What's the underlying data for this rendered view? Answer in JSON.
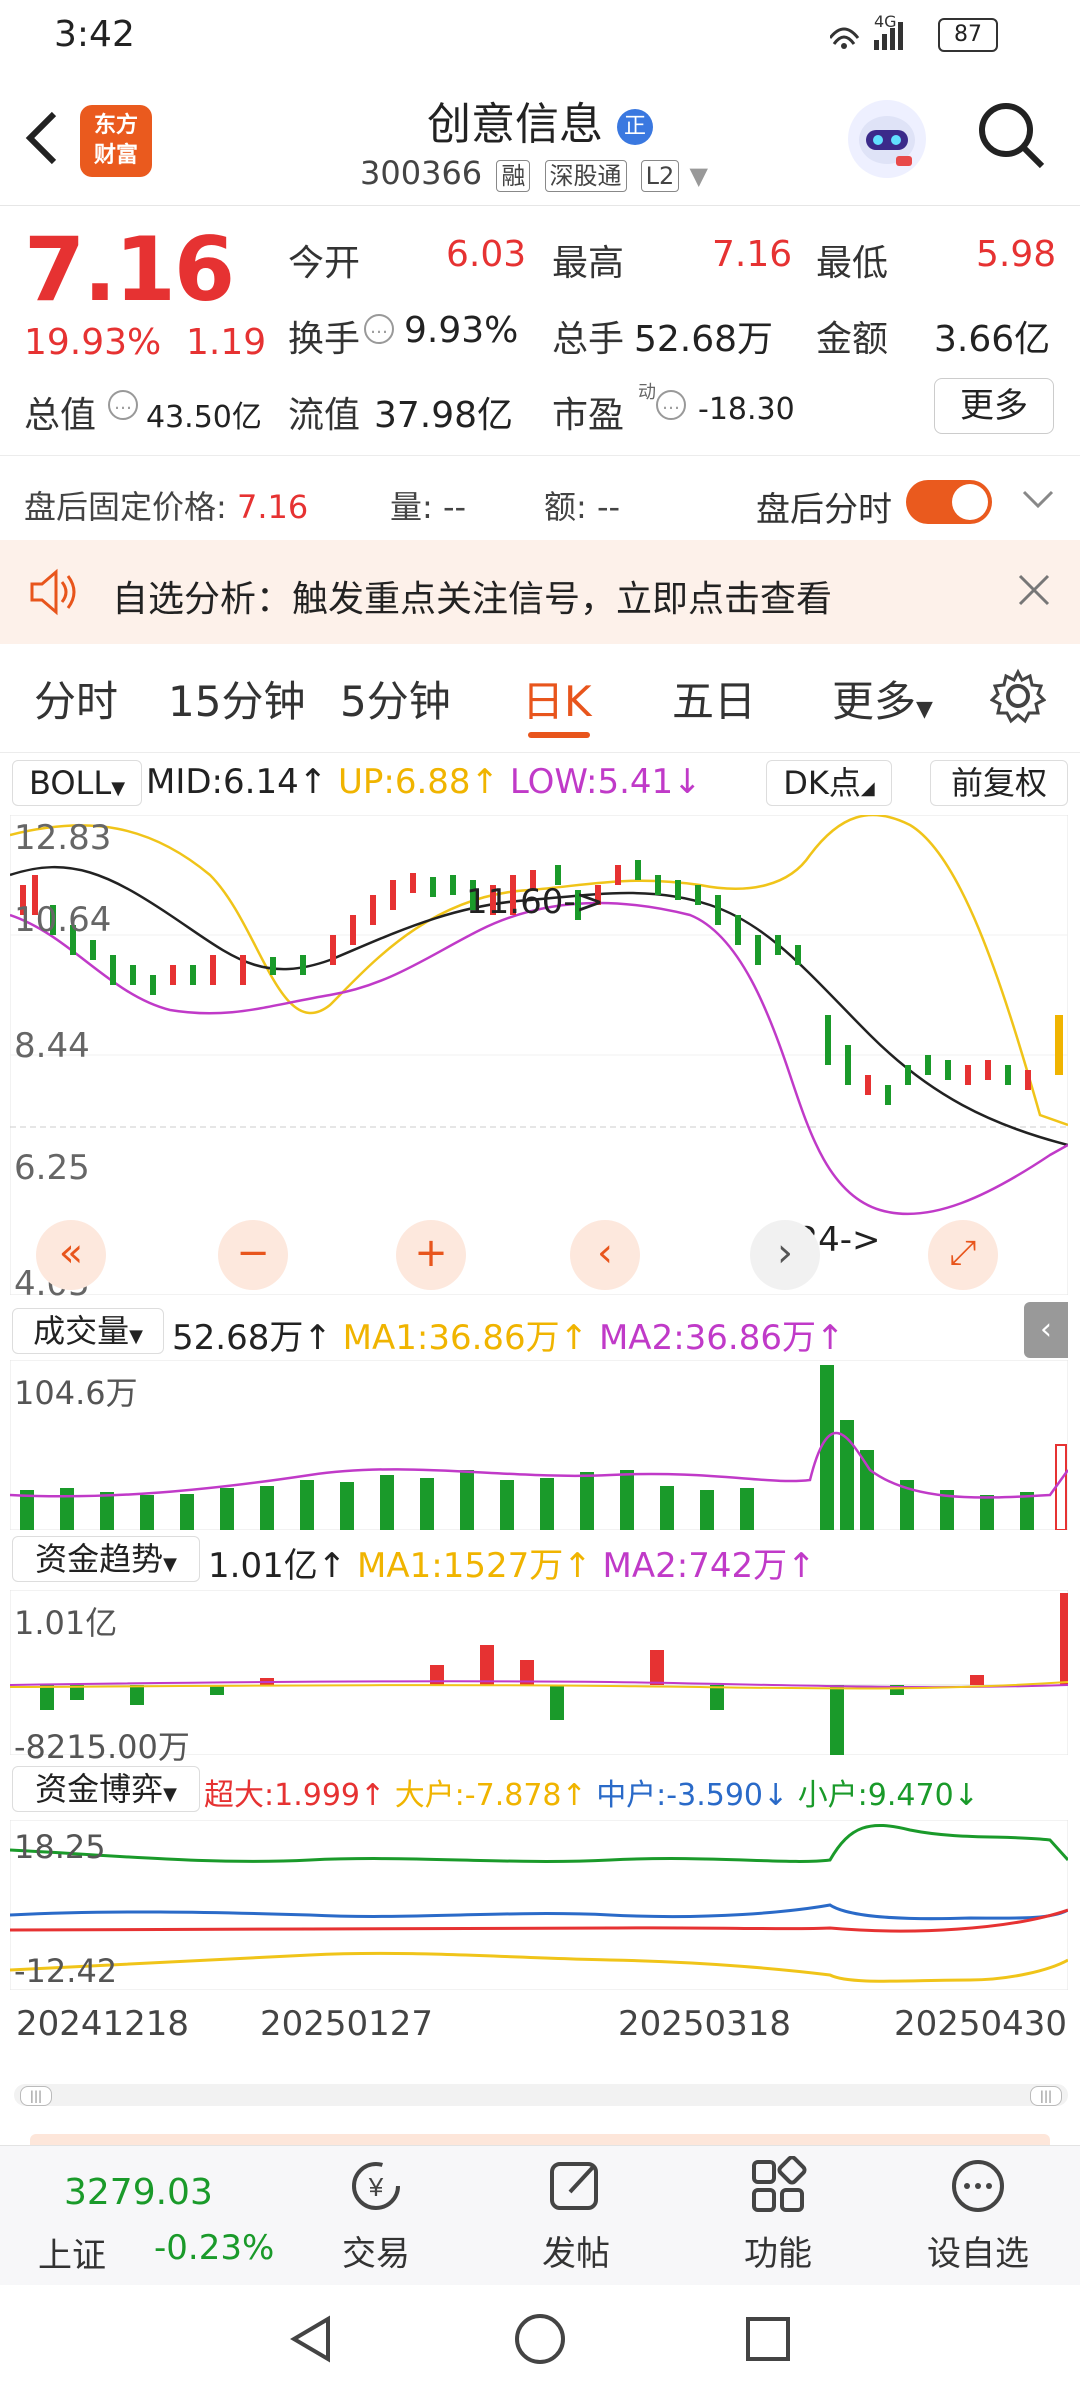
{
  "status": {
    "time": "3:42",
    "network": "4G",
    "battery": "87"
  },
  "header": {
    "logo_line1": "东方",
    "logo_line2": "财富",
    "stock_name": "创意信息",
    "name_badge": "正",
    "stock_code": "300366",
    "tags": [
      "融",
      "深股通",
      "L2"
    ]
  },
  "quote": {
    "price": "7.16",
    "change_pct": "19.93%",
    "change": "1.19",
    "open_label": "今开",
    "open": "6.03",
    "high_label": "最高",
    "high": "7.16",
    "low_label": "最低",
    "low": "5.98",
    "turnover_label": "换手",
    "turnover": "9.93%",
    "volume_label": "总手",
    "volume": "52.68万",
    "amount_label": "金额",
    "amount": "3.66亿",
    "mktcap_label": "总值",
    "mktcap": "43.50亿",
    "float_label": "流值",
    "float": "37.98亿",
    "pe_label": "市盈",
    "pe_sup": "动",
    "pe": "-18.30",
    "more_button": "更多"
  },
  "afterhours": {
    "price_label": "盘后固定价格:",
    "price": "7.16",
    "vol_label": "量:",
    "vol": "--",
    "amt_label": "额:",
    "amt": "--",
    "timeshare_label": "盘后分时"
  },
  "alert": {
    "text": "自选分析：触发重点关注信号，立即点击查看"
  },
  "tabs": [
    "分时",
    "15分钟",
    "5分钟",
    "日K",
    "五日",
    "更多",
    "⚙"
  ],
  "active_tab": "日K",
  "kline": {
    "indicator": "BOLL",
    "mid": "MID:6.14↑",
    "up": "UP:6.88↑",
    "low": "LOW:5.41↓",
    "dk_button": "DK点",
    "adjust_button": "前复权",
    "y_labels": [
      "12.83",
      "10.64",
      "8.44",
      "6.25",
      "4.05"
    ],
    "annotation_high": "11.60->",
    "annotation_low": "5.24->"
  },
  "volume": {
    "label": "成交量",
    "value": "52.68万↑",
    "ma1": "MA1:36.86万↑",
    "ma2": "MA2:36.86万↑",
    "max": "104.6万"
  },
  "fund_trend": {
    "label": "资金趋势",
    "value": "1.01亿↑",
    "ma1": "MA1:1527万↑",
    "ma2": "MA2:742万↑",
    "max": "1.01亿",
    "min": "-8215.00万"
  },
  "fund_game": {
    "label": "资金博弈",
    "super": "超大:1.999↑",
    "large": "大户:-7.878↑",
    "medium": "中户:-3.590↓",
    "small": "小户:9.470↓",
    "max": "18.25",
    "min": "-12.42"
  },
  "dates": [
    "20241218",
    "20250127",
    "20250318",
    "20250430"
  ],
  "bottom_nav": {
    "index_value": "3279.03",
    "index_name": "上证",
    "index_change": "-0.23%",
    "items": [
      "交易",
      "发帖",
      "功能",
      "设自选"
    ]
  },
  "colors": {
    "up": "#e63232",
    "down": "#1a9a2a",
    "accent": "#e8551c",
    "mid": "#222222",
    "upper": "#f0c419",
    "lower": "#c03ac8"
  }
}
